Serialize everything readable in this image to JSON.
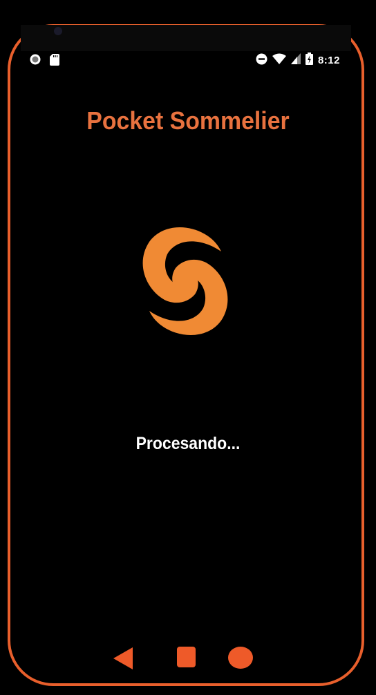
{
  "status_bar": {
    "time": "8:12",
    "left_icons": [
      "record-icon",
      "sd-card-icon"
    ],
    "right_icons": [
      "do-not-disturb-icon",
      "wifi-icon",
      "cell-signal-icon",
      "battery-charging-icon"
    ]
  },
  "app": {
    "title": "Pocket Sommelier",
    "logo": "swirl-logo",
    "processing_text": "Procesando..."
  },
  "nav_bar": {
    "buttons": [
      "back-icon",
      "home-icon",
      "recents-icon"
    ]
  },
  "colors": {
    "accent": "#e85f2c",
    "title": "#e8723f",
    "logo": "#f08a34",
    "background": "#000000",
    "text": "#ffffff"
  }
}
